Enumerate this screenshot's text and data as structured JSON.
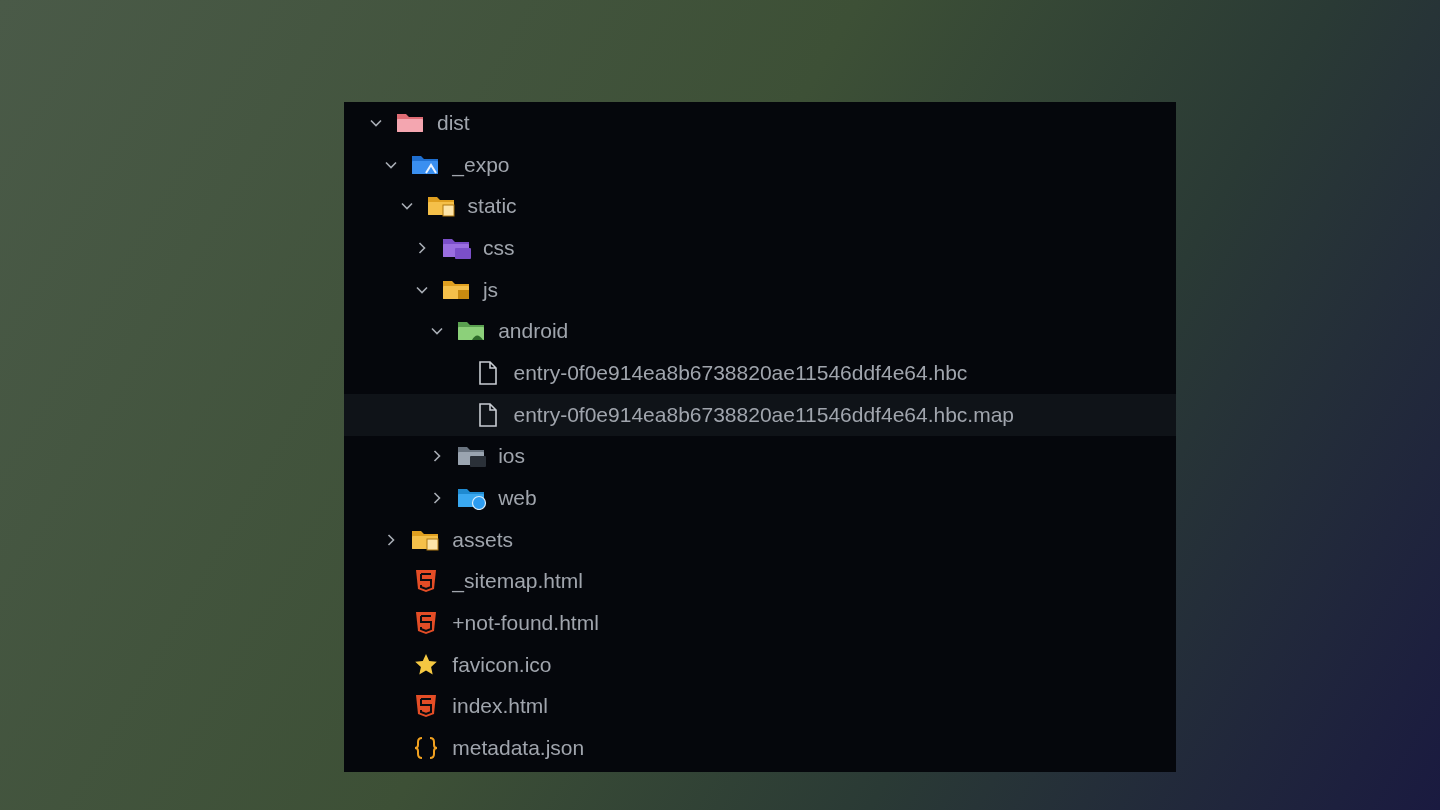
{
  "tree": [
    {
      "name": "dist",
      "kind": "distfolder",
      "expanded": true,
      "selected": false,
      "children": [
        {
          "name": "_expo",
          "kind": "expofolder",
          "expanded": true,
          "selected": false,
          "children": [
            {
              "name": "static",
              "kind": "staticfolder",
              "expanded": true,
              "selected": false,
              "children": [
                {
                  "name": "css",
                  "kind": "cssfolder",
                  "expanded": false,
                  "selected": false
                },
                {
                  "name": "js",
                  "kind": "jsfolder",
                  "expanded": true,
                  "selected": false,
                  "children": [
                    {
                      "name": "android",
                      "kind": "androidfolder",
                      "expanded": true,
                      "selected": false,
                      "children": [
                        {
                          "name": "entry-0f0e914ea8b6738820ae11546ddf4e64.hbc",
                          "kind": "file",
                          "selected": false
                        },
                        {
                          "name": "entry-0f0e914ea8b6738820ae11546ddf4e64.hbc.map",
                          "kind": "file",
                          "selected": true
                        }
                      ]
                    },
                    {
                      "name": "ios",
                      "kind": "iosfolder",
                      "expanded": false,
                      "selected": false
                    },
                    {
                      "name": "web",
                      "kind": "webfolder",
                      "expanded": false,
                      "selected": false
                    }
                  ]
                }
              ]
            }
          ]
        },
        {
          "name": "assets",
          "kind": "assetsfolder",
          "expanded": false,
          "selected": false
        },
        {
          "name": "_sitemap.html",
          "kind": "html",
          "selected": false
        },
        {
          "name": "+not-found.html",
          "kind": "html",
          "selected": false
        },
        {
          "name": "favicon.ico",
          "kind": "favicon",
          "selected": false
        },
        {
          "name": "index.html",
          "kind": "html",
          "selected": false
        },
        {
          "name": "metadata.json",
          "kind": "json",
          "selected": false
        }
      ]
    }
  ]
}
